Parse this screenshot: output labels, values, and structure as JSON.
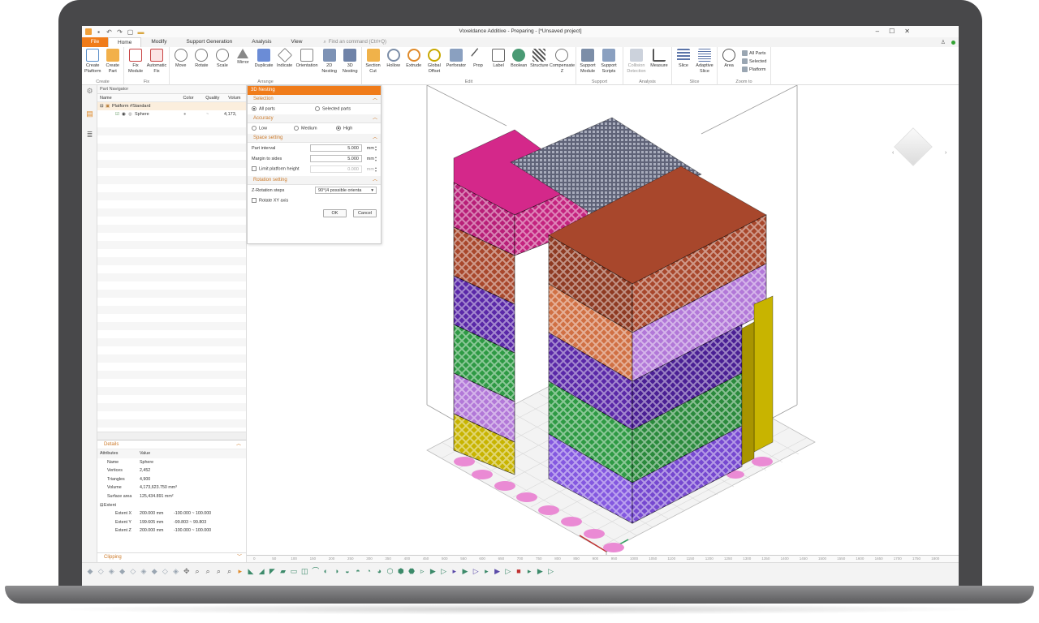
{
  "window": {
    "title": "Voxeldance Additive - Preparing - [*Unsaved project]"
  },
  "tabs": [
    "File",
    "Home",
    "Modify",
    "Support Generation",
    "Analysis",
    "View"
  ],
  "search": {
    "placeholder": "Find an command (Ctrl+Q)"
  },
  "ribbon": {
    "groups": [
      {
        "label": "Create",
        "buttons": [
          "Create Platform",
          "Create Part"
        ]
      },
      {
        "label": "Fix",
        "buttons": [
          "Fix Module",
          "Automatic Fix"
        ]
      },
      {
        "label": "Arrange",
        "buttons": [
          "Move",
          "Rotate",
          "Scale",
          "Mirror",
          "Duplicate",
          "Indicate",
          "Orientation",
          "2D Nesting",
          "3D Nesting"
        ]
      },
      {
        "label": "Edit",
        "buttons": [
          "Section Cut",
          "Hollow",
          "Extrude",
          "Global Offset",
          "Perforator",
          "Prop",
          "Label",
          "Boolean",
          "Structure",
          "Compensate Z"
        ]
      },
      {
        "label": "Support",
        "buttons": [
          "Support Module",
          "Support Scripts"
        ]
      },
      {
        "label": "Analysis",
        "buttons": [
          "Collision Detection",
          "Measure"
        ]
      },
      {
        "label": "Slice",
        "buttons": [
          "Slice",
          "Adaptive Slice"
        ]
      },
      {
        "label": "Zoom to",
        "buttons": [
          "Area"
        ],
        "small": [
          "All Parts",
          "Selected",
          "Platform"
        ]
      }
    ]
  },
  "navigator": {
    "title": "Part Navigator",
    "columns": [
      "Name",
      "Color",
      "Quality",
      "Volum"
    ],
    "platform": "Platform #Standard",
    "part": {
      "name": "Sphere",
      "color": "●",
      "quality": "~",
      "volume": "4,173,"
    }
  },
  "details": {
    "title": "Details",
    "columns": [
      "Attributes",
      "Value"
    ],
    "rows": [
      {
        "k": "Name",
        "v": "Sphere"
      },
      {
        "k": "Vertices",
        "v": "2,452"
      },
      {
        "k": "Triangles",
        "v": "4,900"
      },
      {
        "k": "Volume",
        "v": "4,173,623.750 mm³"
      },
      {
        "k": "Surface area",
        "v": "125,434.891 mm²"
      }
    ],
    "extent_label": "Extent",
    "extents": [
      {
        "k": "Extent X",
        "v": "200.000 mm",
        "r": "-100.000 ~ 100.000"
      },
      {
        "k": "Extent Y",
        "v": "199.605 mm",
        "r": "-99.803 ~ 99.803"
      },
      {
        "k": "Extent Z",
        "v": "200.000 mm",
        "r": "-100.000 ~ 100.000"
      }
    ],
    "clipping": "Clipping"
  },
  "dialog": {
    "title": "3D Nesting",
    "selection": {
      "title": "Selection",
      "options": [
        "All parts",
        "Selected parts"
      ],
      "selected": 0
    },
    "accuracy": {
      "title": "Accuracy",
      "options": [
        "Low",
        "Medium",
        "High"
      ],
      "selected": 2
    },
    "space": {
      "title": "Space setting",
      "part_interval_label": "Part interval",
      "part_interval": "5.000",
      "margin_label": "Margin to sides",
      "margin": "5.000",
      "limit_label": "Limit platform height",
      "limit": "0.000",
      "unit": "mm"
    },
    "rotation": {
      "title": "Rotation setting",
      "steps_label": "Z-Rotation steps",
      "steps": "90°(4 possible orienta",
      "xy_label": "Rotate XY axis"
    },
    "ok": "OK",
    "cancel": "Cancel"
  },
  "ruler": {
    "ticks": [
      "0",
      "50",
      "100",
      "150",
      "200",
      "250",
      "300",
      "350",
      "400",
      "450",
      "500",
      "550",
      "600",
      "650",
      "700",
      "750",
      "800",
      "850",
      "900",
      "950",
      "1000",
      "1050",
      "1100",
      "1150",
      "1200",
      "1250",
      "1300",
      "1350",
      "1400",
      "1450",
      "1500",
      "1550",
      "1600",
      "1650",
      "1700",
      "1750",
      "1800"
    ]
  },
  "colors": {
    "accent": "#f07c1a",
    "sectionText": "#cc7a2a",
    "magenta": "#d4288a",
    "brown": "#a8472c",
    "purple": "#5a28a8",
    "green": "#2e9a44",
    "yellow": "#c8b400",
    "lavender": "#b278d8",
    "pink": "#e879c4"
  }
}
